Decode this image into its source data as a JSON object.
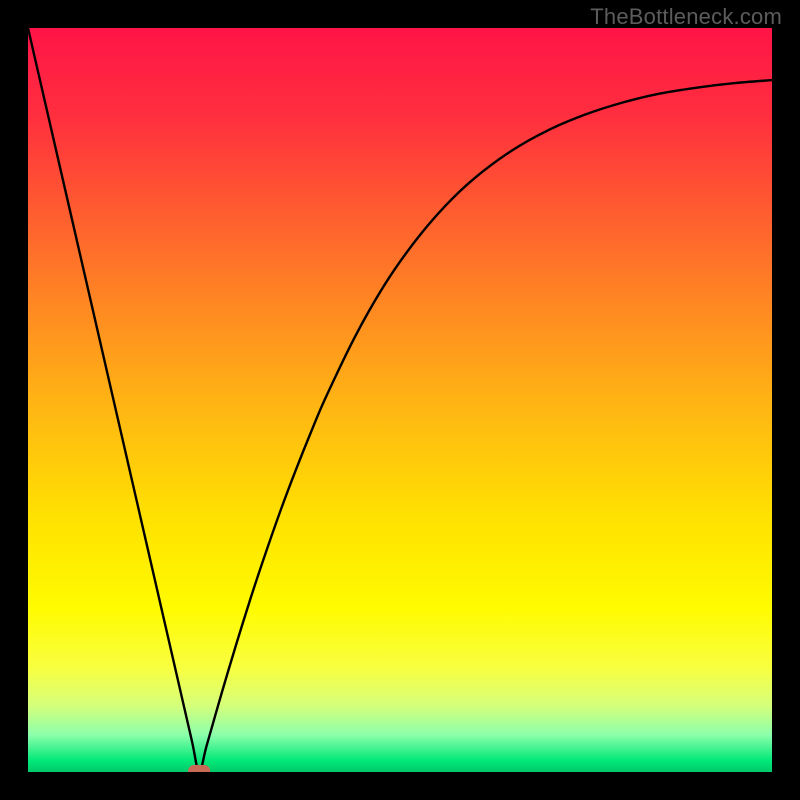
{
  "attribution": "TheBottleneck.com",
  "chart_data": {
    "type": "line",
    "title": "",
    "xlabel": "",
    "ylabel": "",
    "xlim": [
      0,
      100
    ],
    "ylim": [
      0,
      100
    ],
    "x": [
      0,
      2,
      4,
      6,
      8,
      10,
      12,
      14,
      16,
      18,
      20,
      22,
      23,
      24,
      26,
      28,
      30,
      32,
      34,
      36,
      38,
      40,
      44,
      48,
      52,
      56,
      60,
      65,
      70,
      75,
      80,
      85,
      90,
      95,
      100
    ],
    "y": [
      100,
      91.3,
      82.6,
      73.9,
      65.2,
      56.5,
      47.8,
      39.1,
      30.4,
      21.7,
      13.0,
      4.3,
      0,
      3.5,
      10.5,
      17.2,
      23.6,
      29.6,
      35.3,
      40.6,
      45.6,
      50.3,
      58.6,
      65.6,
      71.3,
      76.0,
      79.8,
      83.5,
      86.3,
      88.4,
      90.0,
      91.2,
      92.0,
      92.6,
      93.0
    ],
    "marker": {
      "x": 23,
      "y": 0,
      "shape": "rounded-rect",
      "color": "#c96a57"
    },
    "background_gradient": {
      "stops": [
        {
          "offset": 0.0,
          "color": "#ff1447"
        },
        {
          "offset": 0.12,
          "color": "#ff2f3e"
        },
        {
          "offset": 0.3,
          "color": "#ff6f2a"
        },
        {
          "offset": 0.5,
          "color": "#ffb314"
        },
        {
          "offset": 0.66,
          "color": "#ffe200"
        },
        {
          "offset": 0.78,
          "color": "#fffb00"
        },
        {
          "offset": 0.86,
          "color": "#f8ff40"
        },
        {
          "offset": 0.91,
          "color": "#d6ff7a"
        },
        {
          "offset": 0.95,
          "color": "#8cffab"
        },
        {
          "offset": 0.985,
          "color": "#00e878"
        },
        {
          "offset": 1.0,
          "color": "#00c86a"
        }
      ]
    }
  }
}
